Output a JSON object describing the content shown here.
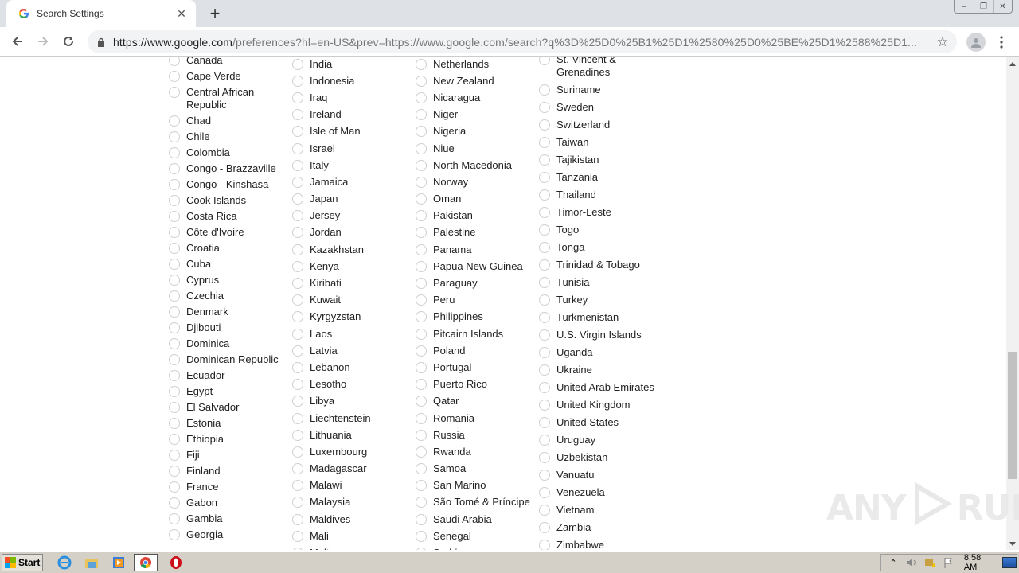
{
  "browser": {
    "tab": {
      "title": "Search Settings",
      "favicon": "google-g-icon"
    },
    "url": {
      "host": "https://www.google.com",
      "rest": "/preferences?hl=en-US&prev=https://www.google.com/search?q%3D%25D0%25B1%25D1%2580%25D0%25BE%25D1%2588%25D1..."
    },
    "window_controls": {
      "minimize": "–",
      "restore": "❐",
      "close": "✕"
    }
  },
  "regions": {
    "columns": [
      {
        "items": [
          "Canada",
          "Cape Verde",
          "Central African Republic",
          "Chad",
          "Chile",
          "Colombia",
          "Congo - Brazzaville",
          "Congo - Kinshasa",
          "Cook Islands",
          "Costa Rica",
          "Côte d'Ivoire",
          "Croatia",
          "Cuba",
          "Cyprus",
          "Czechia",
          "Denmark",
          "Djibouti",
          "Dominica",
          "Dominican Republic",
          "Ecuador",
          "Egypt",
          "El Salvador",
          "Estonia",
          "Ethiopia",
          "Fiji",
          "Finland",
          "France",
          "Gabon",
          "Gambia",
          "Georgia"
        ]
      },
      {
        "items": [
          "India",
          "Indonesia",
          "Iraq",
          "Ireland",
          "Isle of Man",
          "Israel",
          "Italy",
          "Jamaica",
          "Japan",
          "Jersey",
          "Jordan",
          "Kazakhstan",
          "Kenya",
          "Kiribati",
          "Kuwait",
          "Kyrgyzstan",
          "Laos",
          "Latvia",
          "Lebanon",
          "Lesotho",
          "Libya",
          "Liechtenstein",
          "Lithuania",
          "Luxembourg",
          "Madagascar",
          "Malawi",
          "Malaysia",
          "Maldives",
          "Mali",
          "Malta"
        ]
      },
      {
        "items": [
          "Netherlands",
          "New Zealand",
          "Nicaragua",
          "Niger",
          "Nigeria",
          "Niue",
          "North Macedonia",
          "Norway",
          "Oman",
          "Pakistan",
          "Palestine",
          "Panama",
          "Papua New Guinea",
          "Paraguay",
          "Peru",
          "Philippines",
          "Pitcairn Islands",
          "Poland",
          "Portugal",
          "Puerto Rico",
          "Qatar",
          "Romania",
          "Russia",
          "Rwanda",
          "Samoa",
          "San Marino",
          "São Tomé & Príncipe",
          "Saudi Arabia",
          "Senegal",
          "Serbia"
        ]
      },
      {
        "items": [
          "St. Vincent & Grenadines",
          "Suriname",
          "Sweden",
          "Switzerland",
          "Taiwan",
          "Tajikistan",
          "Tanzania",
          "Thailand",
          "Timor-Leste",
          "Togo",
          "Tonga",
          "Trinidad & Tobago",
          "Tunisia",
          "Turkey",
          "Turkmenistan",
          "U.S. Virgin Islands",
          "Uganda",
          "Ukraine",
          "United Arab Emirates",
          "United Kingdom",
          "United States",
          "Uruguay",
          "Uzbekistan",
          "Vanuatu",
          "Venezuela",
          "Vietnam",
          "Zambia",
          "Zimbabwe"
        ]
      }
    ]
  },
  "watermark": {
    "left": "ANY",
    "right": "RUN"
  },
  "taskbar": {
    "start_label": "Start",
    "apps": [
      "internet-explorer-icon",
      "file-explorer-icon",
      "media-player-icon",
      "chrome-icon",
      "opera-icon"
    ],
    "clock": "8:58 AM"
  }
}
